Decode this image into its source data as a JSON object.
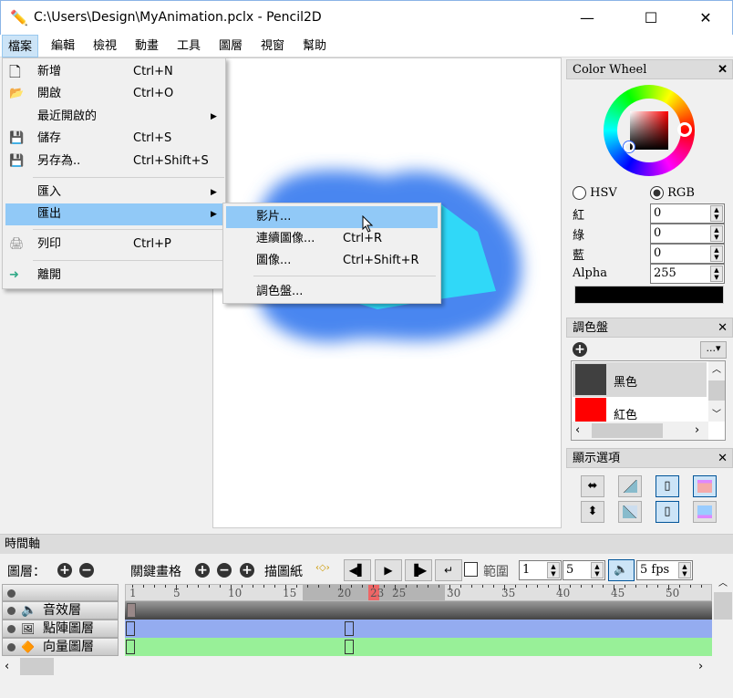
{
  "window": {
    "title": "C:\\Users\\Design\\MyAnimation.pclx - Pencil2D",
    "minimize": "—",
    "maximize": "☐",
    "close": "✕"
  },
  "menubar": [
    "檔案",
    "編輯",
    "檢視",
    "動畫",
    "工具",
    "圖層",
    "視窗",
    "幫助"
  ],
  "file_menu": [
    {
      "label": "新增",
      "shortcut": "Ctrl+N",
      "icon": "new-file-icon"
    },
    {
      "label": "開啟",
      "shortcut": "Ctrl+O",
      "icon": "open-folder-icon"
    },
    {
      "label": "最近開啟的",
      "shortcut": "",
      "submenu": true
    },
    {
      "label": "儲存",
      "shortcut": "Ctrl+S",
      "icon": "save-icon"
    },
    {
      "label": "另存為..",
      "shortcut": "Ctrl+Shift+S",
      "icon": "save-as-icon"
    },
    {
      "label": "匯入",
      "shortcut": "",
      "submenu": true
    },
    {
      "label": "匯出",
      "shortcut": "",
      "submenu": true
    },
    {
      "label": "列印",
      "shortcut": "Ctrl+P",
      "icon": "print-icon"
    },
    {
      "label": "離開",
      "shortcut": "",
      "icon": "exit-icon"
    }
  ],
  "export_menu": [
    {
      "label": "影片...",
      "shortcut": ""
    },
    {
      "label": "連續圖像...",
      "shortcut": "Ctrl+R"
    },
    {
      "label": "圖像...",
      "shortcut": "Ctrl+Shift+R"
    },
    {
      "label": "調色盤...",
      "shortcut": ""
    }
  ],
  "color_wheel": {
    "title": "Color Wheel",
    "hsv": "HSV",
    "rgb": "RGB",
    "mode": "RGB",
    "red_label": "紅",
    "green_label": "綠",
    "blue_label": "藍",
    "alpha_label": "Alpha",
    "red": "0",
    "green": "0",
    "blue": "0",
    "alpha": "255",
    "current_color": "#000000"
  },
  "palette": {
    "title": "調色盤",
    "more": "...",
    "colors": [
      {
        "name": "黑色",
        "hex": "#404040"
      },
      {
        "name": "紅色",
        "hex": "#ff0000"
      }
    ]
  },
  "display": {
    "title": "顯示選項"
  },
  "timeline": {
    "title": "時間軸",
    "layers_label": "圖層：",
    "keyframe_label": "關鍵畫格",
    "onion_label": "描圖紙",
    "range_label": "範圍",
    "range_start": "1",
    "range_end": "5",
    "fps": "5 fps",
    "ruler_ticks": [
      "1",
      "5",
      "10",
      "15",
      "20",
      "23",
      "25",
      "30",
      "35",
      "40",
      "45",
      "50"
    ],
    "current_frame": 23,
    "layers": [
      {
        "name": "音效層",
        "color": "#707070"
      },
      {
        "name": "點陣圖層",
        "color": "#94acf0"
      },
      {
        "name": "向量圖層",
        "color": "#98f098"
      }
    ]
  }
}
